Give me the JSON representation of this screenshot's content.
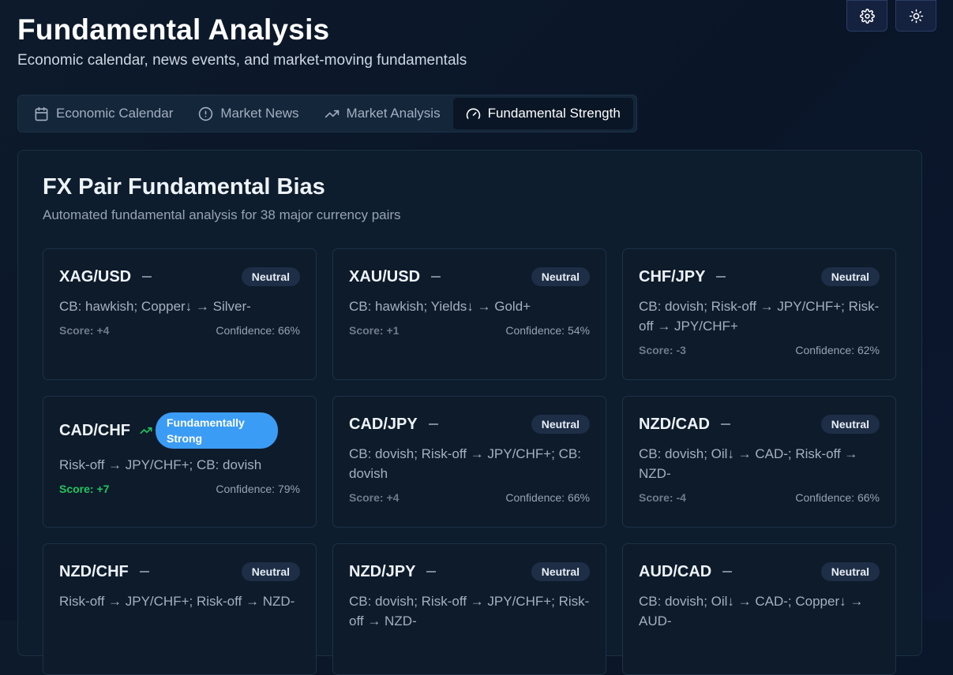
{
  "header": {
    "title": "Fundamental Analysis",
    "subtitle": "Economic calendar, news events, and market-moving fundamentals"
  },
  "top_buttons": {
    "settings_icon": "gear-icon",
    "theme_icon": "sun-icon"
  },
  "tabs": [
    {
      "label": "Economic Calendar",
      "icon": "calendar-icon",
      "active": false
    },
    {
      "label": "Market News",
      "icon": "alert-circle-icon",
      "active": false
    },
    {
      "label": "Market Analysis",
      "icon": "trending-up-icon",
      "active": false
    },
    {
      "label": "Fundamental Strength",
      "icon": "gauge-icon",
      "active": true
    }
  ],
  "panel": {
    "title": "FX Pair Fundamental Bias",
    "subtitle": "Automated fundamental analysis for 38 major currency pairs",
    "cards": [
      {
        "pair": "XAG/USD",
        "badge": "Neutral",
        "reason": "CB: hawkish; Copper↓ → Silver-",
        "score": "Score: +4",
        "confidence": "Confidence: 66%"
      },
      {
        "pair": "XAU/USD",
        "badge": "Neutral",
        "reason": "CB: hawkish; Yields↓ → Gold+",
        "score": "Score: +1",
        "confidence": "Confidence: 54%"
      },
      {
        "pair": "CHF/JPY",
        "badge": "Neutral",
        "reason": "CB: dovish; Risk-off → JPY/CHF+; Risk-off → JPY/CHF+",
        "score": "Score: -3",
        "confidence": "Confidence: 62%"
      },
      {
        "pair": "CAD/CHF",
        "badge": "Fundamentally Strong",
        "strong": true,
        "reason": "Risk-off → JPY/CHF+; CB: dovish",
        "score": "Score: +7",
        "confidence": "Confidence: 79%"
      },
      {
        "pair": "CAD/JPY",
        "badge": "Neutral",
        "reason": "CB: dovish; Risk-off → JPY/CHF+; CB: dovish",
        "score": "Score: +4",
        "confidence": "Confidence: 66%"
      },
      {
        "pair": "NZD/CAD",
        "badge": "Neutral",
        "reason": "CB: dovish; Oil↓ → CAD-; Risk-off → NZD-",
        "score": "Score: -4",
        "confidence": "Confidence: 66%"
      },
      {
        "pair": "NZD/CHF",
        "badge": "Neutral",
        "reason": "Risk-off → JPY/CHF+; Risk-off → NZD-",
        "score": "",
        "confidence": ""
      },
      {
        "pair": "NZD/JPY",
        "badge": "Neutral",
        "reason": "CB: dovish; Risk-off → JPY/CHF+; Risk-off → NZD-",
        "score": "",
        "confidence": ""
      },
      {
        "pair": "AUD/CAD",
        "badge": "Neutral",
        "reason": "CB: dovish; Oil↓ → CAD-; Copper↓ → AUD-",
        "score": "",
        "confidence": ""
      }
    ]
  },
  "colors": {
    "accent": "#3b9cf5",
    "positive": "#22c55e",
    "background": "#0a1628"
  }
}
